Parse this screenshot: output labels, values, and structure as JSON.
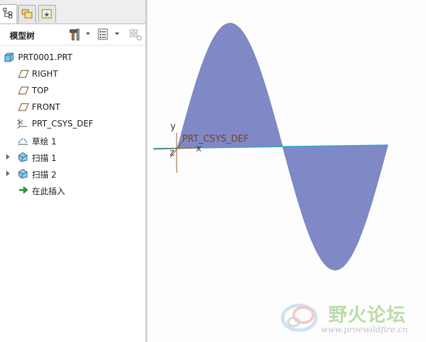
{
  "panel": {
    "toolbar_label": "模型树",
    "tabs": [
      {
        "name": "model-tree-tab",
        "icon": "tree-icon",
        "active": true
      },
      {
        "name": "folder-browser-tab",
        "icon": "folder-icon",
        "active": false
      },
      {
        "name": "favorites-tab",
        "icon": "favorites-icon",
        "active": false
      }
    ]
  },
  "tree": {
    "root": "PRT0001.PRT",
    "items": [
      {
        "label": "RIGHT",
        "icon": "datum-plane-icon",
        "expandable": false
      },
      {
        "label": "TOP",
        "icon": "datum-plane-icon",
        "expandable": false
      },
      {
        "label": "FRONT",
        "icon": "datum-plane-icon",
        "expandable": false
      },
      {
        "label": "PRT_CSYS_DEF",
        "icon": "coordinate-system-icon",
        "expandable": false
      },
      {
        "label": "草绘 1",
        "icon": "sketch-icon",
        "expandable": false
      },
      {
        "label": "扫描 1",
        "icon": "sweep-icon",
        "expandable": true
      },
      {
        "label": "扫描 2",
        "icon": "sweep-icon",
        "expandable": true
      },
      {
        "label": "在此插入",
        "icon": "insert-here-arrow-icon",
        "expandable": false
      }
    ]
  },
  "viewport": {
    "csys_label": "PRT_CSYS_DEF",
    "axis_labels": {
      "x": "x",
      "y": "y",
      "z": "z"
    },
    "surface_color": "#7f89c6",
    "baseline_color": "#2aa8c9",
    "csys_color": "#8a5a2a"
  },
  "watermark": {
    "title": "野火论坛",
    "url": "www.proewildfire.cn"
  }
}
